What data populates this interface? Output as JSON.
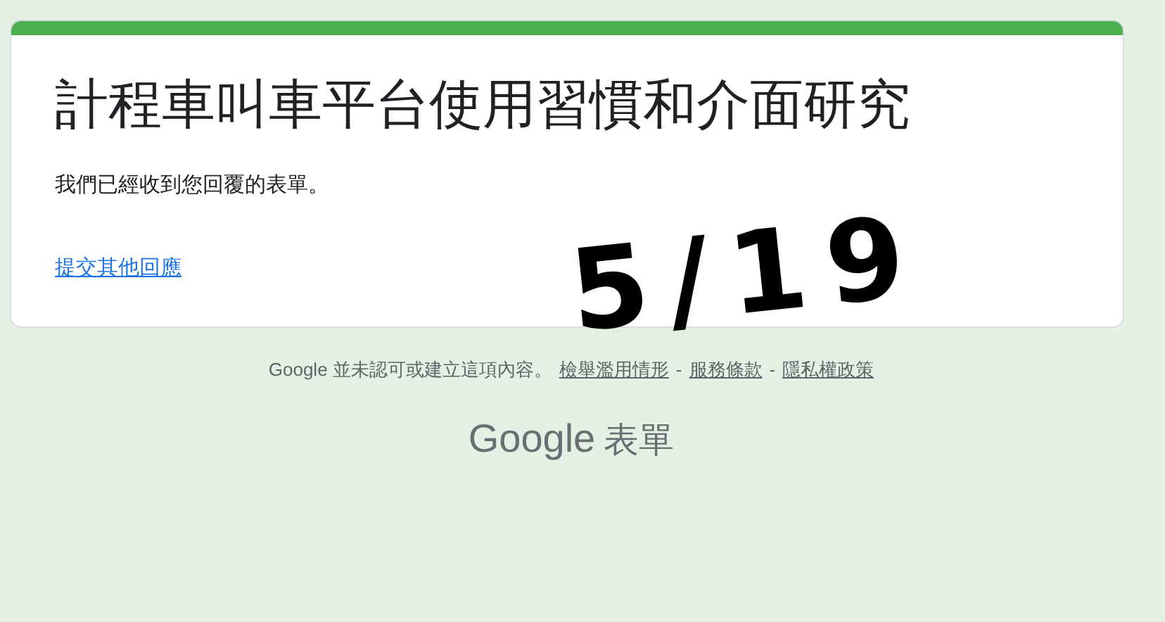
{
  "form": {
    "title": "計程車叫車平台使用習慣和介面研究",
    "message": "我們已經收到您回覆的表單。",
    "another_response_link": "提交其他回應"
  },
  "handwritten_note": "5/19",
  "footer": {
    "disclaimer": "Google 並未認可或建立這項內容。",
    "links": [
      {
        "label": "檢舉濫用情形"
      },
      {
        "label": "服務條款"
      },
      {
        "label": "隱私權政策"
      }
    ],
    "separator": "-"
  },
  "logo": {
    "brand": "Google",
    "product": "表單"
  }
}
